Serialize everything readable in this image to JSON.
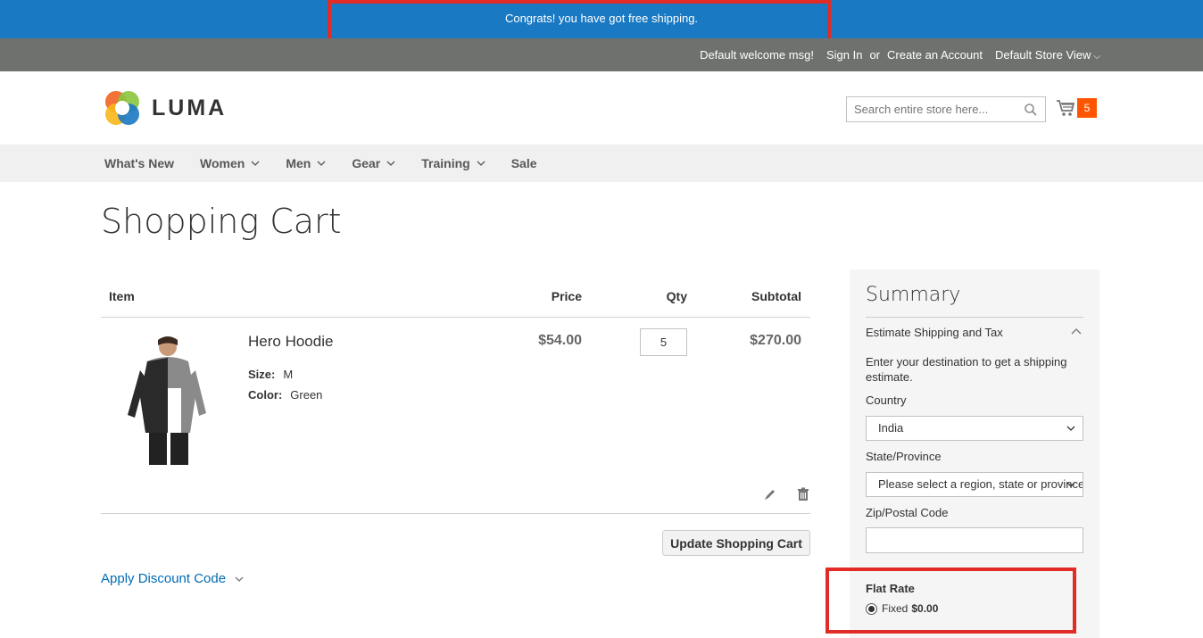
{
  "promo": {
    "text": "Congrats! you have got free shipping."
  },
  "topbar": {
    "welcome": "Default welcome msg!",
    "sign_in": "Sign In",
    "or": "or",
    "create_account": "Create an Account",
    "store_view": "Default Store View"
  },
  "header": {
    "logo_text": "LUMA",
    "search_placeholder": "Search entire store here...",
    "cart_count": "5"
  },
  "nav": {
    "items": [
      {
        "label": "What's New"
      },
      {
        "label": "Women"
      },
      {
        "label": "Men"
      },
      {
        "label": "Gear"
      },
      {
        "label": "Training"
      },
      {
        "label": "Sale"
      }
    ]
  },
  "page": {
    "title": "Shopping Cart"
  },
  "cart": {
    "columns": {
      "item": "Item",
      "price": "Price",
      "qty": "Qty",
      "subtotal": "Subtotal"
    },
    "items": [
      {
        "name": "Hero Hoodie",
        "size_label": "Size:",
        "size": "M",
        "color_label": "Color:",
        "color": "Green",
        "price": "$54.00",
        "qty": "5",
        "subtotal": "$270.00"
      }
    ],
    "update_button": "Update Shopping Cart",
    "discount_label": "Apply Discount Code"
  },
  "summary": {
    "title": "Summary",
    "estimate_title": "Estimate Shipping and Tax",
    "estimate_text": "Enter your destination to get a shipping estimate.",
    "country_label": "Country",
    "country_value": "India",
    "state_label": "State/Province",
    "state_value": "Please select a region, state or province.",
    "zip_label": "Zip/Postal Code",
    "zip_value": "",
    "flat_rate_title": "Flat Rate",
    "flat_rate_option": "Fixed",
    "flat_rate_price": "$0.00"
  },
  "colors": {
    "promo_bg": "#1979c3",
    "topbar_bg": "#6e716e",
    "nav_bg": "#f0f0f0",
    "cart_badge": "#ff5501",
    "highlight": "#e02b27",
    "summary_bg": "#f5f5f5",
    "link": "#006bb4"
  }
}
